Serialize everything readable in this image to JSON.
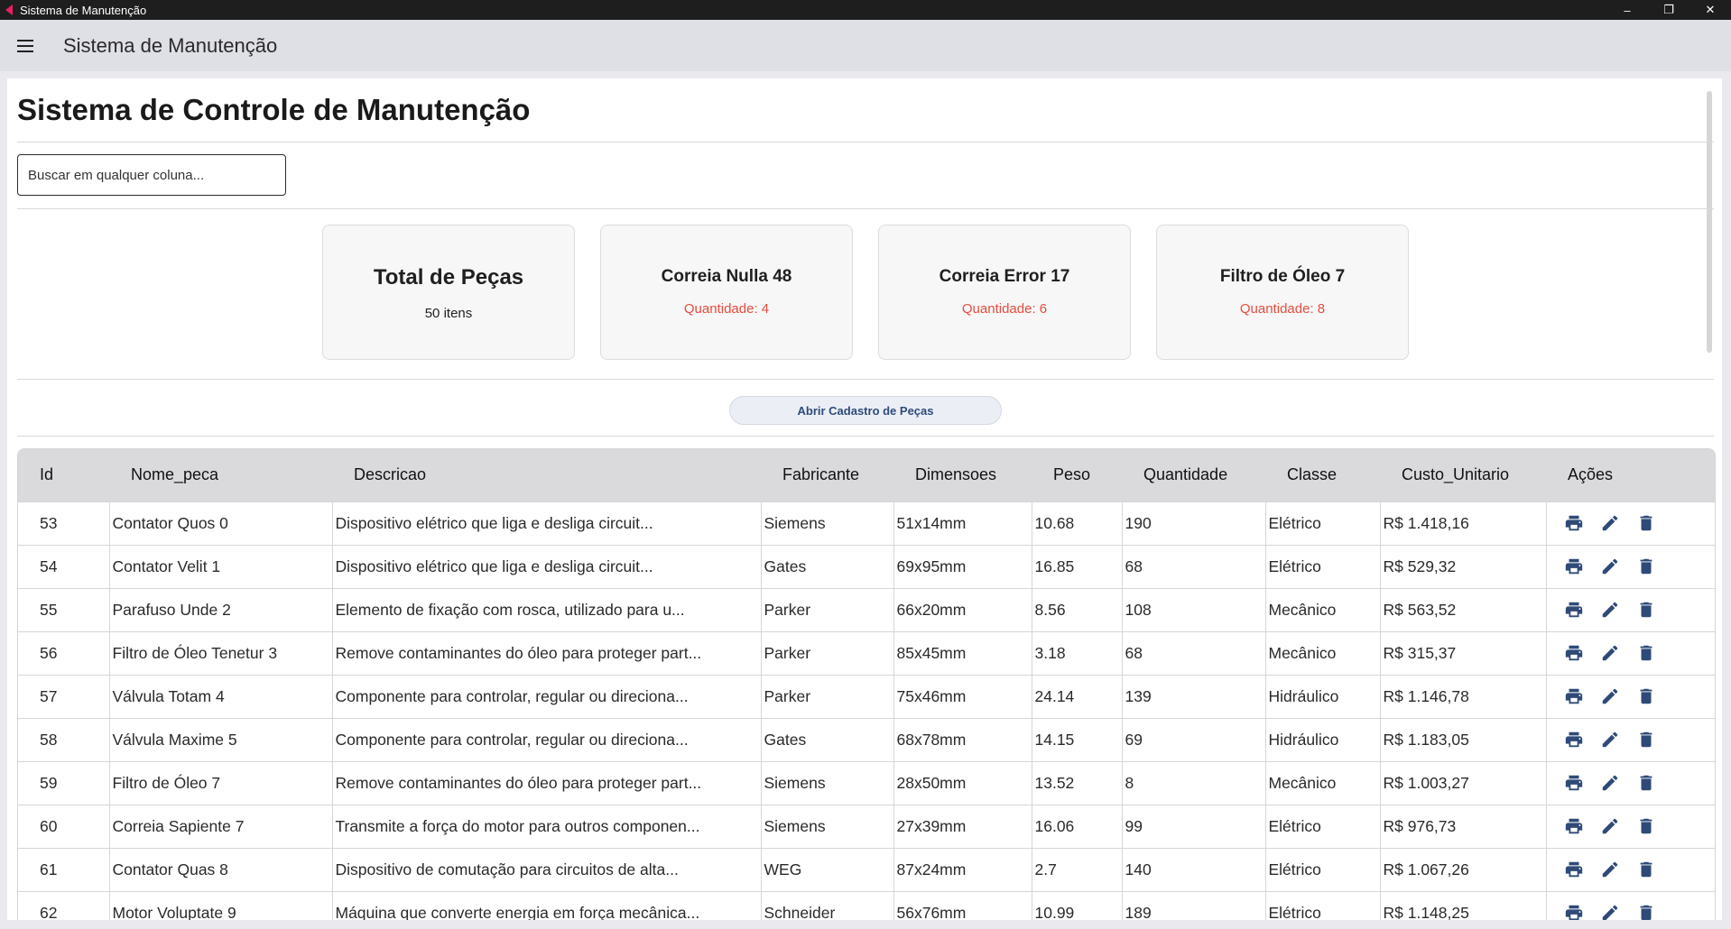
{
  "window": {
    "title": "Sistema de Manutenção",
    "controls": {
      "minimize": "–",
      "restore": "❐",
      "close": "✕"
    }
  },
  "appbar": {
    "title": "Sistema de Manutenção"
  },
  "page": {
    "title": "Sistema de Controle de Manutenção"
  },
  "search": {
    "placeholder": "Buscar em qualquer coluna..."
  },
  "stats": {
    "total": {
      "title": "Total de Peças",
      "subtitle": "50 itens"
    },
    "items": [
      {
        "title": "Correia Nulla 48",
        "subtitle": "Quantidade: 4"
      },
      {
        "title": "Correia Error 17",
        "subtitle": "Quantidade: 6"
      },
      {
        "title": "Filtro de Óleo 7",
        "subtitle": "Quantidade: 8"
      }
    ]
  },
  "open_button": {
    "label": "Abrir Cadastro de Peças"
  },
  "table": {
    "headers": [
      "Id",
      "Nome_peca",
      "Descricao",
      "Fabricante",
      "Dimensoes",
      "Peso",
      "Quantidade",
      "Classe",
      "Custo_Unitario",
      "Ações"
    ],
    "rows": [
      [
        "53",
        "Contator Quos 0",
        "Dispositivo elétrico que liga e desliga circuit...",
        "Siemens",
        "51x14mm",
        "10.68",
        "190",
        "Elétrico",
        "R$ 1.418,16"
      ],
      [
        "54",
        "Contator Velit 1",
        "Dispositivo elétrico que liga e desliga circuit...",
        "Gates",
        "69x95mm",
        "16.85",
        "68",
        "Elétrico",
        "R$ 529,32"
      ],
      [
        "55",
        "Parafuso Unde 2",
        "Elemento de fixação com rosca, utilizado para u...",
        "Parker",
        "66x20mm",
        "8.56",
        "108",
        "Mecânico",
        "R$ 563,52"
      ],
      [
        "56",
        "Filtro de Óleo Tenetur 3",
        "Remove contaminantes do óleo para proteger part...",
        "Parker",
        "85x45mm",
        "3.18",
        "68",
        "Mecânico",
        "R$ 315,37"
      ],
      [
        "57",
        "Válvula Totam 4",
        "Componente para controlar, regular ou direciona...",
        "Parker",
        "75x46mm",
        "24.14",
        "139",
        "Hidráulico",
        "R$ 1.146,78"
      ],
      [
        "58",
        "Válvula Maxime 5",
        "Componente para controlar, regular ou direciona...",
        "Gates",
        "68x78mm",
        "14.15",
        "69",
        "Hidráulico",
        "R$ 1.183,05"
      ],
      [
        "59",
        "Filtro de Óleo 7",
        "Remove contaminantes do óleo para proteger part...",
        "Siemens",
        "28x50mm",
        "13.52",
        "8",
        "Mecânico",
        "R$ 1.003,27"
      ],
      [
        "60",
        "Correia Sapiente 7",
        "Transmite a força do motor para outros componen...",
        "Siemens",
        "27x39mm",
        "16.06",
        "99",
        "Elétrico",
        "R$ 976,73"
      ],
      [
        "61",
        "Contator Quas 8",
        "Dispositivo de comutação para circuitos de alta...",
        "WEG",
        "87x24mm",
        "2.7",
        "140",
        "Elétrico",
        "R$ 1.067,26"
      ],
      [
        "62",
        "Motor Voluptate 9",
        "Máquina que converte energia em força mecânica...",
        "Schneider",
        "56x76mm",
        "10.99",
        "189",
        "Elétrico",
        "R$ 1.148,25"
      ]
    ],
    "row_actions": [
      "print-icon",
      "edit-icon",
      "delete-icon"
    ]
  },
  "colors": {
    "accent_red": "#e74c3c",
    "action_icon": "#2f4a78",
    "header_bg": "#dadadd",
    "appbar_bg": "#dfdfe6"
  }
}
